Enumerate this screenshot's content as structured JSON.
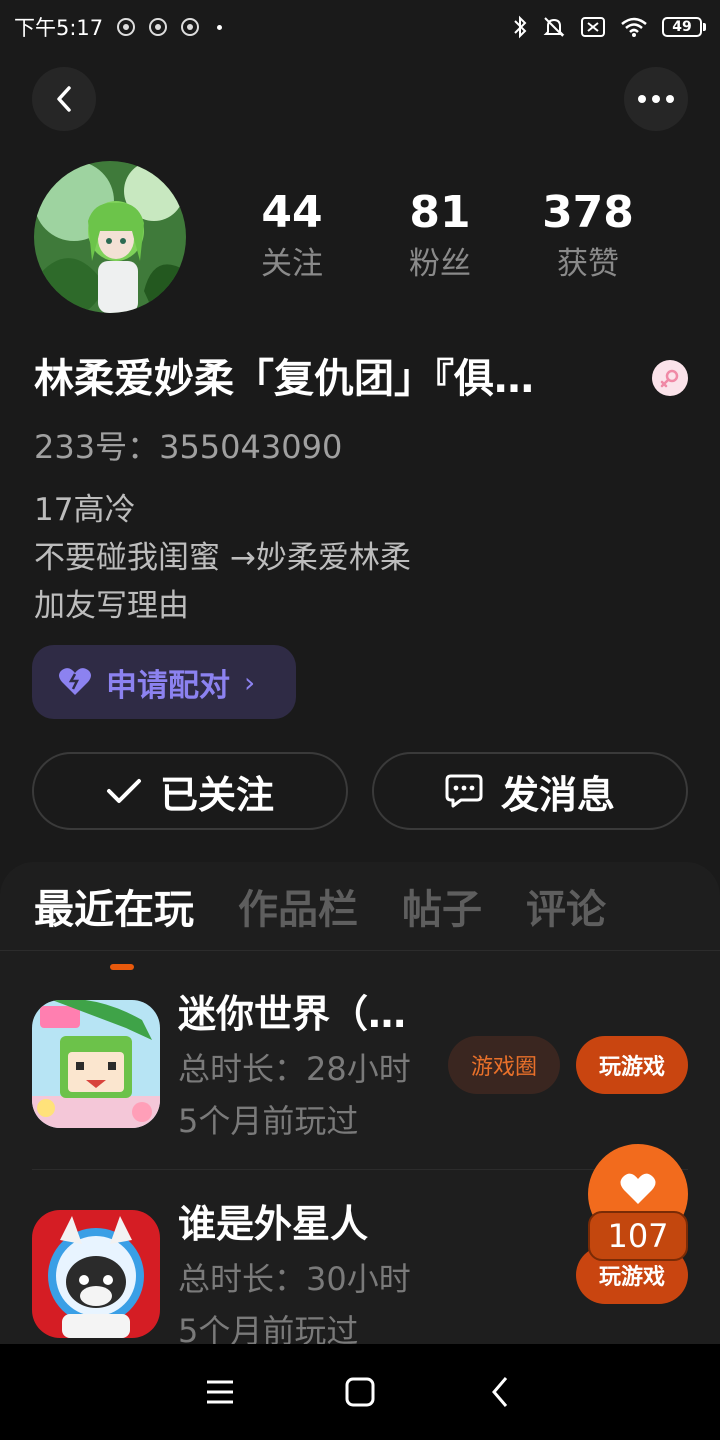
{
  "status_bar": {
    "time": "下午5:17",
    "battery": "49"
  },
  "profile": {
    "stats": [
      {
        "value": "44",
        "label": "关注"
      },
      {
        "value": "81",
        "label": "粉丝"
      },
      {
        "value": "378",
        "label": "获赞"
      }
    ],
    "username": "林柔爱妙柔「复仇团」『俱…",
    "id_text": "233号：355043090",
    "bio": [
      "17高冷",
      "不要碰我闺蜜 →妙柔爱林柔",
      "加友写理由"
    ],
    "pair_label": "申请配对",
    "follow_label": "已关注",
    "message_label": "发消息"
  },
  "tabs": [
    {
      "label": "最近在玩"
    },
    {
      "label": "作品栏"
    },
    {
      "label": "帖子"
    },
    {
      "label": "评论"
    }
  ],
  "games": [
    {
      "name": "迷你世界（…",
      "duration": "总时长：28小时",
      "last_played": "5个月前玩过",
      "circle_label": "游戏圈",
      "play_label": "玩游戏"
    },
    {
      "name": "谁是外星人",
      "duration": "总时长：30小时",
      "last_played": "5个月前玩过",
      "play_label": "玩游戏"
    }
  ],
  "like_count": "107",
  "icons": {
    "back": "back-icon",
    "more": "more-icon",
    "gender": "female-icon",
    "heart": "heart-icon",
    "check": "check-icon",
    "message": "message-icon",
    "nav_menu": "menu-icon",
    "nav_home": "home-icon",
    "nav_back": "nav-back-icon"
  },
  "colors": {
    "accent_orange": "#f26b1d",
    "pair_purple": "#8c82f0",
    "background": "#1a1a1a"
  }
}
